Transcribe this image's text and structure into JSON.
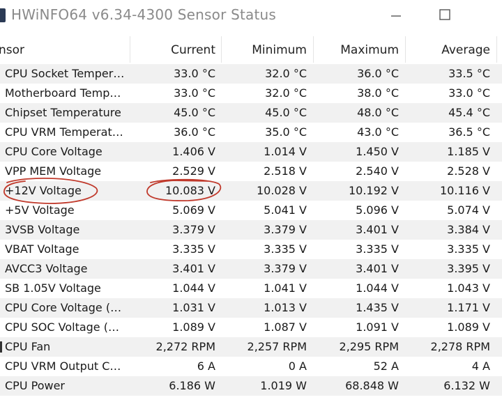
{
  "window": {
    "title": "HWiNFO64 v6.34-4300 Sensor Status",
    "icons": {
      "app": "hwinfo-app-icon",
      "minimize": "minimize-icon",
      "maximize": "maximize-icon"
    }
  },
  "columns": [
    "nsor",
    "Current",
    "Minimum",
    "Maximum",
    "Average"
  ],
  "rows": [
    {
      "sensor": "CPU Socket Temper…",
      "current": "33.0 °C",
      "min": "32.0 °C",
      "max": "36.0 °C",
      "avg": "33.5 °C"
    },
    {
      "sensor": "Motherboard Temp…",
      "current": "33.0 °C",
      "min": "32.0 °C",
      "max": "38.0 °C",
      "avg": "33.0 °C"
    },
    {
      "sensor": "Chipset Temperature",
      "current": "45.0 °C",
      "min": "45.0 °C",
      "max": "48.0 °C",
      "avg": "45.4 °C"
    },
    {
      "sensor": "CPU VRM Temperat…",
      "current": "36.0 °C",
      "min": "35.0 °C",
      "max": "43.0 °C",
      "avg": "36.5 °C"
    },
    {
      "sensor": "CPU Core Voltage",
      "current": "1.406 V",
      "min": "1.014 V",
      "max": "1.450 V",
      "avg": "1.185 V"
    },
    {
      "sensor": "VPP MEM Voltage",
      "current": "2.529 V",
      "min": "2.518 V",
      "max": "2.540 V",
      "avg": "2.528 V"
    },
    {
      "sensor": "+12V Voltage",
      "current": "10.083 V",
      "min": "10.028 V",
      "max": "10.192 V",
      "avg": "10.116 V"
    },
    {
      "sensor": "+5V Voltage",
      "current": "5.069 V",
      "min": "5.041 V",
      "max": "5.096 V",
      "avg": "5.074 V"
    },
    {
      "sensor": "3VSB Voltage",
      "current": "3.379 V",
      "min": "3.379 V",
      "max": "3.401 V",
      "avg": "3.384 V"
    },
    {
      "sensor": "VBAT Voltage",
      "current": "3.335 V",
      "min": "3.335 V",
      "max": "3.335 V",
      "avg": "3.335 V"
    },
    {
      "sensor": "AVCC3 Voltage",
      "current": "3.401 V",
      "min": "3.379 V",
      "max": "3.401 V",
      "avg": "3.395 V"
    },
    {
      "sensor": "SB 1.05V Voltage",
      "current": "1.044 V",
      "min": "1.041 V",
      "max": "1.044 V",
      "avg": "1.043 V"
    },
    {
      "sensor": "CPU Core Voltage (…",
      "current": "1.031 V",
      "min": "1.013 V",
      "max": "1.435 V",
      "avg": "1.171 V"
    },
    {
      "sensor": "CPU SOC Voltage (…",
      "current": "1.089 V",
      "min": "1.087 V",
      "max": "1.091 V",
      "avg": "1.089 V"
    },
    {
      "sensor": "CPU Fan",
      "current": "2,272 RPM",
      "min": "2,257 RPM",
      "max": "2,295 RPM",
      "avg": "2,278 RPM"
    },
    {
      "sensor": "CPU VRM Output C…",
      "current": "6 A",
      "min": "0 A",
      "max": "52 A",
      "avg": "4 A"
    },
    {
      "sensor": "CPU Power",
      "current": "6.186 W",
      "min": "1.019 W",
      "max": "68.848 W",
      "avg": "6.132 W"
    }
  ],
  "annotation": {
    "color": "#c0392b",
    "circled": [
      "+12V Voltage",
      "10.083 V"
    ]
  }
}
